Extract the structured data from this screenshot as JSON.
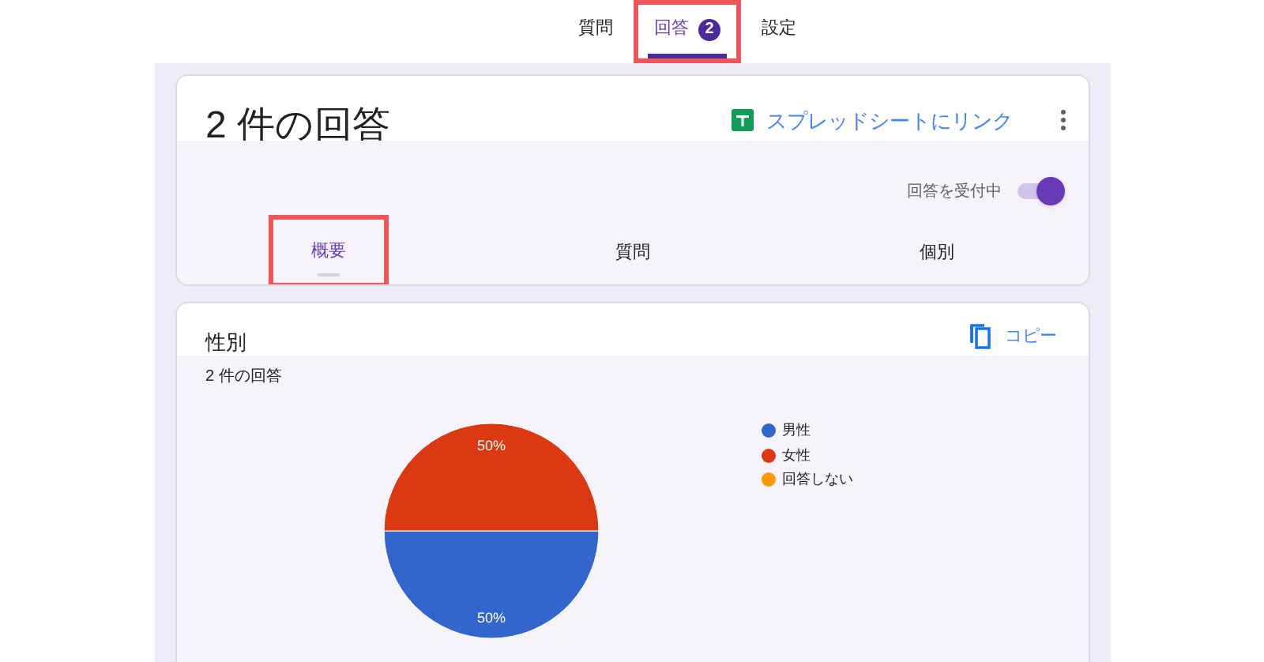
{
  "top_tabs": [
    {
      "label": "質問",
      "selected": false,
      "highlighted": false
    },
    {
      "label": "回答",
      "badge": "2",
      "selected": true,
      "highlighted": true
    },
    {
      "label": "設定",
      "selected": false,
      "highlighted": false
    }
  ],
  "summary": {
    "title": "2 件の回答",
    "sheet_link": "スプレッドシートにリンク",
    "accepting_label": "回答を受付中",
    "accepting": true,
    "tabs": [
      {
        "label": "概要",
        "selected": true,
        "highlighted": true
      },
      {
        "label": "質問",
        "selected": false,
        "highlighted": false
      },
      {
        "label": "個別",
        "selected": false,
        "highlighted": false
      }
    ]
  },
  "question": {
    "title": "性別",
    "copy_label": "コピー",
    "response_count": "2 件の回答",
    "chart_data": {
      "type": "pie",
      "categories": [
        "男性",
        "女性",
        "回答しない"
      ],
      "values": [
        50,
        50,
        0
      ],
      "colors": [
        "#3366cc",
        "#dc3912",
        "#ff9900"
      ],
      "value_labels": [
        "50%",
        "50%",
        null
      ]
    }
  }
}
